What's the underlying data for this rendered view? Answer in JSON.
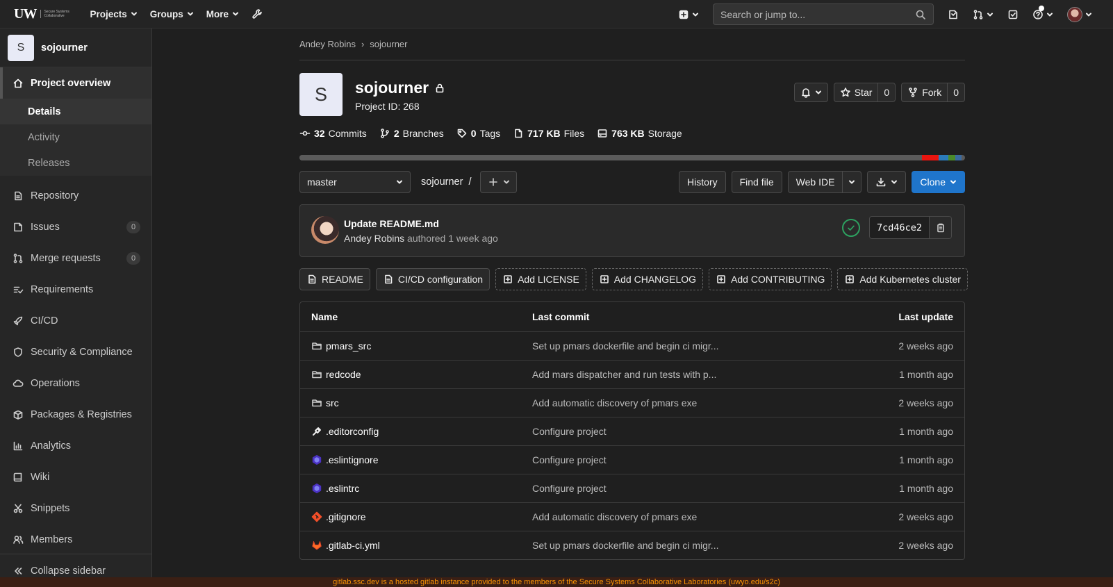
{
  "navbar": {
    "logo_mark": "UW",
    "logo_tagline": "Secure Systems Collaborative",
    "menus": [
      "Projects",
      "Groups",
      "More"
    ],
    "search_placeholder": "Search or jump to..."
  },
  "sidebar": {
    "avatar_letter": "S",
    "project_name": "sojourner",
    "overview": {
      "label": "Project overview",
      "subitems": [
        "Details",
        "Activity",
        "Releases"
      ],
      "current": "Details"
    },
    "items": [
      {
        "label": "Repository",
        "icon": "document-icon"
      },
      {
        "label": "Issues",
        "icon": "issues-icon",
        "count": "0"
      },
      {
        "label": "Merge requests",
        "icon": "merge-request-icon",
        "count": "0"
      },
      {
        "label": "Requirements",
        "icon": "requirements-icon"
      },
      {
        "label": "CI/CD",
        "icon": "rocket-icon"
      },
      {
        "label": "Security & Compliance",
        "icon": "shield-icon"
      },
      {
        "label": "Operations",
        "icon": "cloud-icon"
      },
      {
        "label": "Packages & Registries",
        "icon": "package-icon"
      },
      {
        "label": "Analytics",
        "icon": "chart-icon"
      },
      {
        "label": "Wiki",
        "icon": "book-icon"
      },
      {
        "label": "Snippets",
        "icon": "scissors-icon"
      },
      {
        "label": "Members",
        "icon": "users-icon"
      }
    ],
    "collapse_label": "Collapse sidebar"
  },
  "breadcrumb": {
    "parent": "Andey Robins",
    "separator": "›",
    "current": "sojourner"
  },
  "project": {
    "avatar_letter": "S",
    "name": "sojourner",
    "id_text": "Project ID: 268",
    "star_label": "Star",
    "star_count": "0",
    "fork_label": "Fork",
    "fork_count": "0"
  },
  "stats": [
    {
      "value": "32",
      "label": "Commits",
      "icon": "commit-icon"
    },
    {
      "value": "2",
      "label": "Branches",
      "icon": "branch-icon"
    },
    {
      "value": "0",
      "label": "Tags",
      "icon": "tag-icon"
    },
    {
      "value": "717 KB",
      "label": "Files",
      "icon": "file-icon"
    },
    {
      "value": "763 KB",
      "label": "Storage",
      "icon": "storage-icon"
    }
  ],
  "language_bar": [
    {
      "color": "#5b5b5b",
      "fraction": 0.935
    },
    {
      "color": "#e8150f",
      "fraction": 0.025
    },
    {
      "color": "#2b7bb9",
      "fraction": 0.015
    },
    {
      "color": "#4a8a2a",
      "fraction": 0.01
    },
    {
      "color": "#3a6aa0",
      "fraction": 0.01
    }
  ],
  "tree": {
    "branch": "master",
    "path_root": "sojourner",
    "path_sep": "/",
    "buttons": {
      "history": "History",
      "find_file": "Find file",
      "web_ide": "Web IDE",
      "clone": "Clone"
    }
  },
  "commit": {
    "title": "Update README.md",
    "author": "Andey Robins",
    "meta": " authored 1 week ago",
    "sha": "7cd46ce2"
  },
  "quick_links": [
    {
      "label": "README",
      "style": "solid",
      "icon": "file-icon"
    },
    {
      "label": "CI/CD configuration",
      "style": "solid",
      "icon": "file-icon"
    },
    {
      "label": "Add LICENSE",
      "style": "dashed",
      "icon": "plus-square-icon"
    },
    {
      "label": "Add CHANGELOG",
      "style": "dashed",
      "icon": "plus-square-icon"
    },
    {
      "label": "Add CONTRIBUTING",
      "style": "dashed",
      "icon": "plus-square-icon"
    },
    {
      "label": "Add Kubernetes cluster",
      "style": "dashed",
      "icon": "plus-square-icon"
    }
  ],
  "files": {
    "headers": {
      "name": "Name",
      "commit": "Last commit",
      "date": "Last update"
    },
    "rows": [
      {
        "name": "pmars_src",
        "type": "folder",
        "commit": "Set up pmars dockerfile and begin ci migr...",
        "date": "2 weeks ago"
      },
      {
        "name": "redcode",
        "type": "folder",
        "commit": "Add mars dispatcher and run tests with p...",
        "date": "1 month ago"
      },
      {
        "name": "src",
        "type": "folder",
        "commit": "Add automatic discovery of pmars exe",
        "date": "2 weeks ago"
      },
      {
        "name": ".editorconfig",
        "type": "editorconfig",
        "commit": "Configure project",
        "date": "1 month ago"
      },
      {
        "name": ".eslintignore",
        "type": "eslint",
        "commit": "Configure project",
        "date": "1 month ago"
      },
      {
        "name": ".eslintrc",
        "type": "eslint",
        "commit": "Configure project",
        "date": "1 month ago"
      },
      {
        "name": ".gitignore",
        "type": "git",
        "commit": "Add automatic discovery of pmars exe",
        "date": "2 weeks ago"
      },
      {
        "name": ".gitlab-ci.yml",
        "type": "gitlab",
        "commit": "Set up pmars dockerfile and begin ci migr...",
        "date": "2 weeks ago"
      }
    ]
  },
  "banner": "gitlab.ssc.dev is a hosted gitlab instance provided to the members of the Secure Systems Collaborative Laboratories (uwyo.edu/s2c)"
}
